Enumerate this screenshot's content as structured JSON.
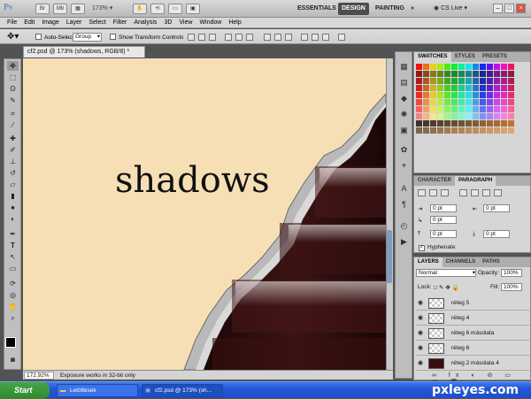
{
  "appbar": {
    "logo": "Ps",
    "br_label": "Br",
    "mb_label": "Mb",
    "zoom": "173%",
    "workspaces": [
      "ESSENTIALS",
      "DESIGN",
      "PAINTING"
    ],
    "more": "»",
    "cslive": "CS Live"
  },
  "menus": [
    "File",
    "Edit",
    "Image",
    "Layer",
    "Select",
    "Filter",
    "Analysis",
    "3D",
    "View",
    "Window",
    "Help"
  ],
  "options": {
    "auto_select_label": "Auto-Select:",
    "auto_select_value": "Group",
    "transform_label": "Show Transform Controls"
  },
  "document": {
    "tab_title": "cf2.psd @ 173% (shadows, RGB/8) *",
    "close": "×",
    "canvas_text": "shadows",
    "zoom_status": "172.92%",
    "status_message": "Exposure works in 32-bit only"
  },
  "swatches": {
    "tabs": [
      "SWATCHES",
      "STYLES",
      "PRESETS"
    ]
  },
  "paragraph": {
    "tabs": [
      "CHARACTER",
      "PARAGRAPH"
    ],
    "fields": [
      "0 pt",
      "0 pt",
      "0 pt",
      "0 pt",
      "0 pt"
    ],
    "hyphenate": "Hyphenate"
  },
  "layers": {
    "tabs": [
      "LAYERS",
      "CHANNELS",
      "PATHS"
    ],
    "blend_mode": "Normal",
    "opacity_label": "Opacity:",
    "opacity_value": "100%",
    "lock_label": "Lock:",
    "fill_label": "Fill:",
    "fill_value": "100%",
    "items": [
      "réteg 5",
      "réteg 4",
      "réteg 6 másolata",
      "réteg 6",
      "réteg 2 másolata 4"
    ]
  },
  "taskbar": {
    "start": "Start",
    "tasks": [
      "Letöltések",
      "cf2.psd @ 173% (sh..."
    ],
    "watermark": "pxleyes.com"
  },
  "colors": {
    "canvas_bg": "#f7dfb5",
    "chocolate": "#2a0c0a",
    "selected_layer": "#7592bf"
  }
}
